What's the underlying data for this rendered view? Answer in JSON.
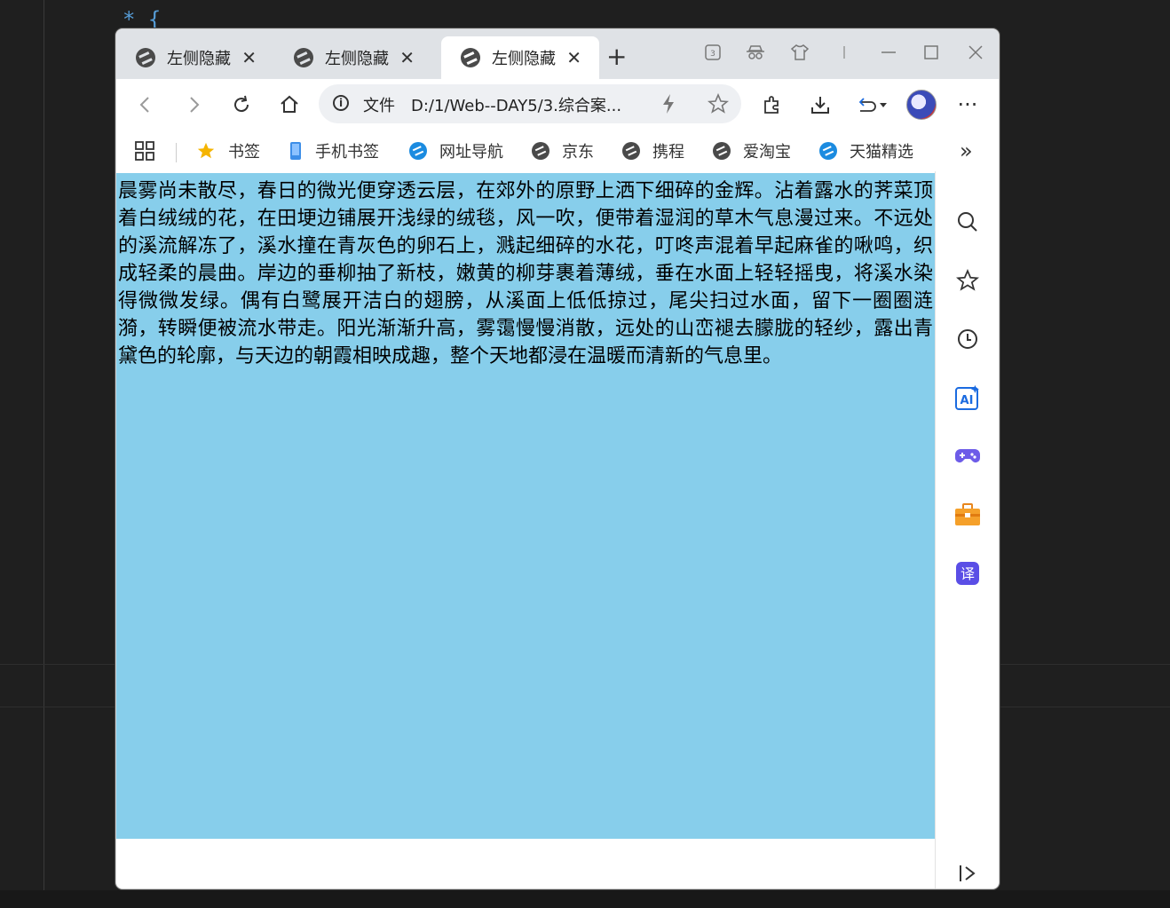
{
  "editor": {
    "code_fragment": "* {"
  },
  "tabs": [
    {
      "title": "左侧隐藏",
      "close": "✕",
      "active": false
    },
    {
      "title": "左侧隐藏",
      "close": "✕",
      "active": false
    },
    {
      "title": "左侧隐藏",
      "close": "✕",
      "active": true
    }
  ],
  "tabstrip": {
    "new_tab": "+",
    "window_controls": [
      "minimize-icon",
      "maximize-icon",
      "close-icon"
    ]
  },
  "toolbar": {
    "back": "‹",
    "forward": "›",
    "refresh": "↻",
    "home": "⌂",
    "address": {
      "info_glyph": "i",
      "label": "文件",
      "url": "D:/1/Web--DAY5/3.综合案..."
    },
    "more": "···"
  },
  "bookmarks": [
    {
      "label": "书签",
      "icon": "star-icon"
    },
    {
      "label": "手机书签",
      "icon": "phone-icon"
    },
    {
      "label": "网址导航",
      "icon": "browser-icon"
    },
    {
      "label": "京东",
      "icon": "browser-icon"
    },
    {
      "label": "携程",
      "icon": "browser-icon"
    },
    {
      "label": "爱淘宝",
      "icon": "browser-icon"
    },
    {
      "label": "天猫精选",
      "icon": "browser-icon"
    }
  ],
  "bookmarks_overflow": "»",
  "page": {
    "background": "#87ceeb",
    "paragraph": "晨雾尚未散尽，春日的微光便穿透云层，在郊外的原野上洒下细碎的金辉。沾着露水的荠菜顶着白绒绒的花，在田埂边铺展开浅绿的绒毯，风一吹，便带着湿润的草木气息漫过来。不远处的溪流解冻了，溪水撞在青灰色的卵石上，溅起细碎的水花，叮咚声混着早起麻雀的啾鸣，织成轻柔的晨曲。岸边的垂柳抽了新枝，嫩黄的柳芽裹着薄绒，垂在水面上轻轻摇曳，将溪水染得微微发绿。偶有白鹭展开洁白的翅膀，从溪面上低低掠过，尾尖扫过水面，留下一圈圈涟漪，转瞬便被流水带走。阳光渐渐升高，雾霭慢慢消散，远处的山峦褪去朦胧的轻纱，露出青黛色的轮廓，与天边的朝霞相映成趣，整个天地都浸在温暖而清新的气息里。"
  },
  "sidebar": {
    "ai_label": "AI",
    "translate_label": "译",
    "collapse": "|>"
  }
}
